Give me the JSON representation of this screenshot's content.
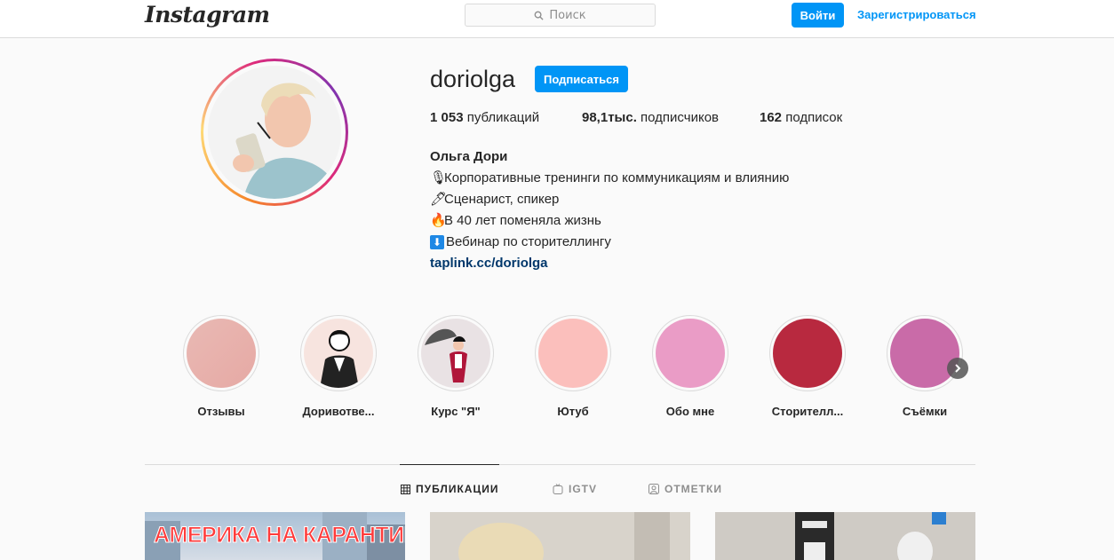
{
  "header": {
    "logo": "Instagram",
    "search_placeholder": "Поиск",
    "login_label": "Войти",
    "register_label": "Зарегистрироваться"
  },
  "profile": {
    "username": "doriolga",
    "follow_label": "Подписаться",
    "stats": {
      "posts_count": "1 053",
      "posts_label": "публикаций",
      "followers_count": "98,1тыс.",
      "followers_label": "подписчиков",
      "following_count": "162",
      "following_label": "подписок"
    },
    "full_name": "Ольга Дори",
    "bio_lines": [
      {
        "icon": "🎙",
        "text": "Корпоративные тренинги по коммуникациям и влиянию"
      },
      {
        "icon": "🖊",
        "text": "Сценарист, спикер"
      },
      {
        "icon": "🔥",
        "text": "В 40 лет поменяла жизнь"
      },
      {
        "icon": "⬇",
        "text": "Вебинар по сторителлингу"
      }
    ],
    "link": "taplink.cc/doriolga"
  },
  "highlights": [
    {
      "label": "Отзывы",
      "color": "#e8b4b0"
    },
    {
      "label": "Доривотве...",
      "color": "#f7e4df"
    },
    {
      "label": "Курс \"Я\"",
      "color": "#e9e2e4"
    },
    {
      "label": "Ютуб",
      "color": "#fbbfbc"
    },
    {
      "label": "Обо мне",
      "color": "#ea9cc6"
    },
    {
      "label": "Сторителл...",
      "color": "#b8293f"
    },
    {
      "label": "Съёмки",
      "color": "#c96ba8"
    }
  ],
  "tabs": [
    {
      "label": "ПУБЛИКАЦИИ",
      "icon": "grid-icon",
      "active": true
    },
    {
      "label": "IGTV",
      "icon": "tv-icon",
      "active": false
    },
    {
      "label": "ОТМЕТКИ",
      "icon": "tagged-icon",
      "active": false
    }
  ],
  "posts": [
    {
      "caption": "АМЕРИКА НА КАРАНТИНЕ"
    },
    {
      "caption": ""
    },
    {
      "caption": ""
    }
  ],
  "colors": {
    "accent": "#0095f6",
    "link": "#00376b",
    "border": "#dbdbdb",
    "background": "#fafafa"
  }
}
